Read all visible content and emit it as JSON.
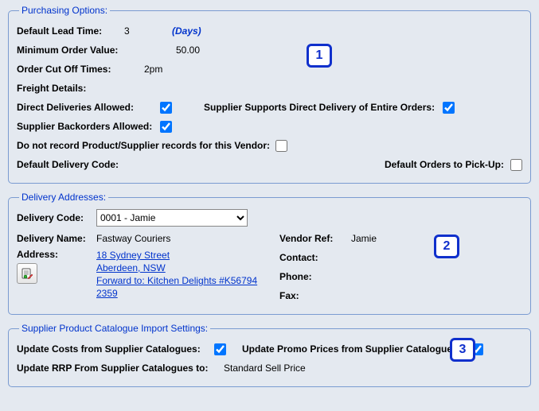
{
  "purchasing": {
    "title": "Purchasing Options:",
    "default_lead_time_label": "Default Lead Time:",
    "default_lead_time_value": "3",
    "default_lead_time_unit": "(Days)",
    "minimum_order_value_label": "Minimum Order Value:",
    "minimum_order_value": "50.00",
    "order_cutoff_label": "Order Cut Off Times:",
    "order_cutoff_value": "2pm",
    "freight_details_label": "Freight Details:",
    "direct_deliveries_label": "Direct Deliveries Allowed:",
    "direct_deliveries_checked": true,
    "supplier_supports_direct_label": "Supplier Supports Direct Delivery of Entire Orders:",
    "supplier_supports_direct_checked": true,
    "backorders_label": "Supplier Backorders Allowed:",
    "backorders_checked": true,
    "do_not_record_label": "Do not record Product/Supplier records for this Vendor:",
    "do_not_record_checked": false,
    "default_delivery_code_label": "Default Delivery Code:",
    "default_orders_pickup_label": "Default Orders to Pick-Up:",
    "default_orders_pickup_checked": false
  },
  "delivery": {
    "title": "Delivery Addresses:",
    "code_label": "Delivery Code:",
    "code_value": "0001 - Jamie",
    "name_label": "Delivery Name:",
    "name_value": "Fastway Couriers",
    "address_label": "Address:",
    "address_line1": "18 Sydney Street",
    "address_line2": "Aberdeen, NSW",
    "address_line3": "Forward to: Kitchen Delights #K56794",
    "address_line4": "2359",
    "vendor_ref_label": "Vendor Ref:",
    "vendor_ref_value": "Jamie",
    "contact_label": "Contact:",
    "phone_label": "Phone:",
    "fax_label": "Fax:"
  },
  "catalogue": {
    "title": "Supplier Product Catalogue Import Settings:",
    "update_costs_label": "Update Costs from Supplier Catalogues:",
    "update_costs_checked": true,
    "update_promo_label": "Update Promo Prices from Supplier Catalogues:",
    "update_promo_checked": true,
    "update_rrp_label": "Update RRP From Supplier Catalogues to:",
    "update_rrp_value": "Standard Sell Price"
  },
  "callouts": {
    "one": "1",
    "two": "2",
    "three": "3"
  }
}
